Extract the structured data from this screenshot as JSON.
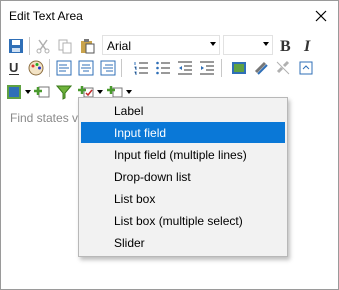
{
  "window": {
    "title": "Edit Text Area"
  },
  "toolbar": {
    "font_value": "Arial",
    "size_value": ""
  },
  "editor": {
    "placeholder": "Find states v"
  },
  "menu": {
    "items": [
      {
        "label": "Label"
      },
      {
        "label": "Input field"
      },
      {
        "label": "Input field (multiple lines)"
      },
      {
        "label": "Drop-down list"
      },
      {
        "label": "List box"
      },
      {
        "label": "List box (multiple select)"
      },
      {
        "label": "Slider"
      }
    ],
    "selected_index": 1
  },
  "colors": {
    "accent": "#0a78d7",
    "menu_bg": "#f2f2f2"
  }
}
